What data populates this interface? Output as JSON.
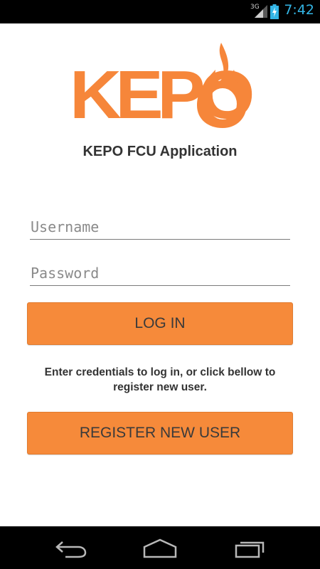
{
  "status_bar": {
    "network": "3G",
    "time": "7:42"
  },
  "logo": {
    "text": "KEPO"
  },
  "app_title": "KEPO FCU Application",
  "login_form": {
    "username_placeholder": "Username",
    "username_value": "",
    "password_placeholder": "Password",
    "password_value": "",
    "login_label": "LOG IN"
  },
  "hint_text": "Enter credentials to log in, or click bellow to register new user.",
  "register_label": "REGISTER NEW USER",
  "nav_bar": {
    "icons": [
      "back-icon",
      "home-icon",
      "recents-icon"
    ]
  },
  "colors": {
    "accent": "#f68a3a",
    "clock": "#33b5e5",
    "status_bar_bg": "#000000"
  }
}
